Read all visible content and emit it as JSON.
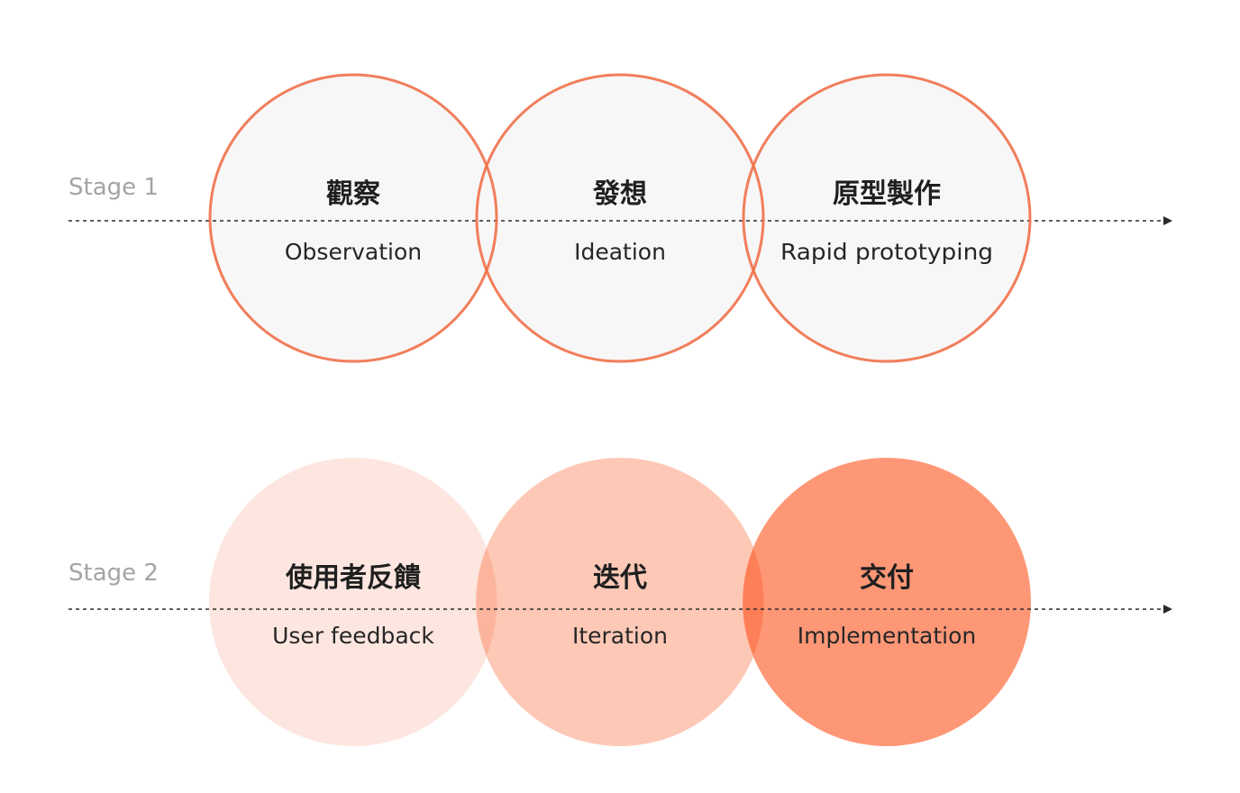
{
  "colors": {
    "stroke_accent": "#f0704a",
    "stage1_fill": "#f7f7f7",
    "stage2_fills": [
      "#fde6df",
      "#fdc9b6",
      "#fe9776"
    ],
    "arrow": "#2a2a2a",
    "stage_label": "#a4a4a4"
  },
  "stages": [
    {
      "label": "Stage 1",
      "style": "outlined",
      "steps": [
        {
          "zh": "觀察",
          "en": "Observation"
        },
        {
          "zh": "發想",
          "en": "Ideation"
        },
        {
          "zh": "原型製作",
          "en": "Rapid prototyping"
        }
      ]
    },
    {
      "label": "Stage 2",
      "style": "filled",
      "steps": [
        {
          "zh": "使用者反饋",
          "en": "User feedback"
        },
        {
          "zh": "迭代",
          "en": "Iteration"
        },
        {
          "zh": "交付",
          "en": "Implementation"
        }
      ]
    }
  ]
}
